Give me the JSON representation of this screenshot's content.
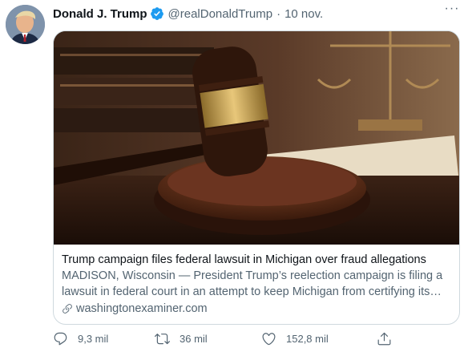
{
  "tweet": {
    "author_name": "Donald J. Trump",
    "author_handle": "@realDonaldTrump",
    "separator": "·",
    "date": "10 nov.",
    "more_label": "···"
  },
  "card": {
    "title": "Trump campaign files federal lawsuit in Michigan over fraud allegations",
    "description": "MADISON, Wisconsin — President Trump’s reelection campaign is filing a lawsuit in federal court in an attempt to keep Michigan from certifying its election results.",
    "domain": "washingtonexaminer.com"
  },
  "actions": {
    "reply_count": "9,3 mil",
    "retweet_count": "36 mil",
    "like_count": "152,8 mil"
  },
  "colors": {
    "accent": "#1d9bf0",
    "secondary_text": "#536471",
    "border": "#cfd9de"
  },
  "icons": [
    "verified-badge-icon",
    "more-icon",
    "link-icon",
    "reply-icon",
    "retweet-icon",
    "like-icon",
    "share-icon"
  ]
}
